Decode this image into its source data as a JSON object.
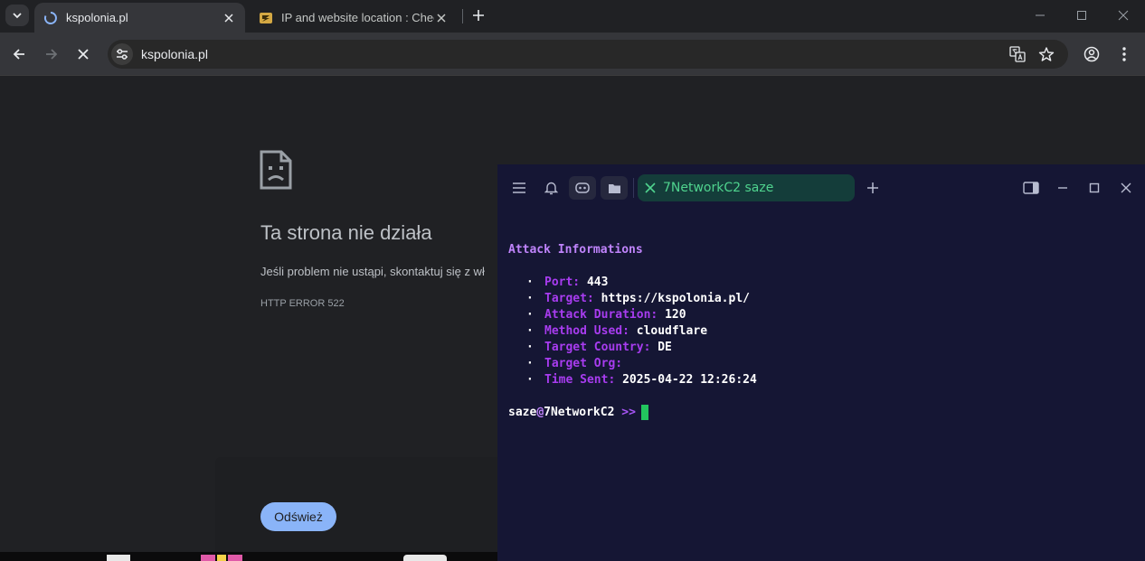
{
  "browser": {
    "tabs": [
      {
        "title": "kspolonia.pl",
        "active": true,
        "loading": true
      },
      {
        "title": "IP and website location : Check",
        "active": false,
        "favicon": "lightning-logo-icon"
      }
    ],
    "omnibox": {
      "url": "kspolonia.pl"
    },
    "colors": {
      "accent": "#8ab4f8",
      "bg": "#202124",
      "toolbar": "#35363a"
    }
  },
  "page": {
    "title": "Ta strona nie działa",
    "description": "Jeśli problem nie ustąpi, skontaktuj się z wł",
    "error_code": "HTTP ERROR 522",
    "reload_label": "Odśwież"
  },
  "terminal": {
    "tab_title": "7NetworkC2 saze",
    "heading": "Attack Informations",
    "items": [
      {
        "key": "Port:",
        "value": "443"
      },
      {
        "key": "Target:",
        "value": "https://kspolonia.pl/"
      },
      {
        "key": "Attack Duration:",
        "value": "120"
      },
      {
        "key": "Method Used:",
        "value": "cloudflare"
      },
      {
        "key": "Target Country:",
        "value": "DE"
      },
      {
        "key": "Target Org:",
        "value": ""
      },
      {
        "key": "Time Sent:",
        "value": "2025-04-22 12:26:24"
      }
    ],
    "prompt": {
      "user": "saze",
      "at": "@",
      "host": "7NetworkC2",
      "arrows": ">>"
    },
    "colors": {
      "bg": "#151634",
      "key": "#a83cf0",
      "heading": "#c084fc",
      "cursor": "#22c55e",
      "tab_text": "#4fd38e"
    }
  }
}
